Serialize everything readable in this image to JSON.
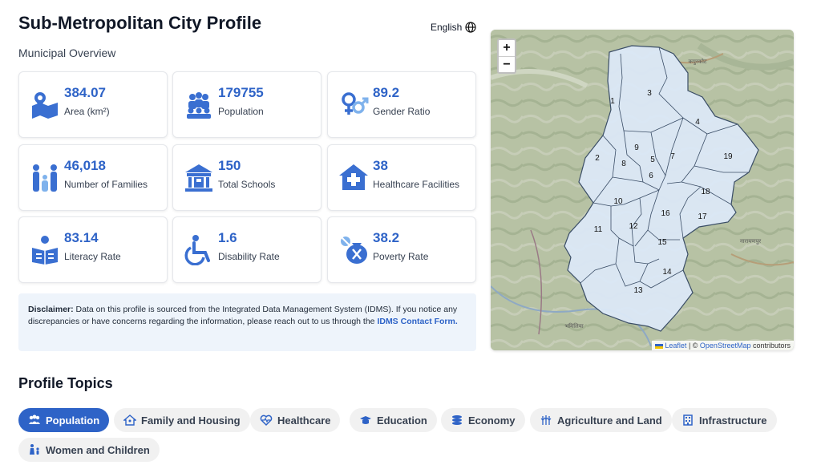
{
  "header": {
    "title": "Sub-Metropolitan City Profile",
    "language": "English",
    "subtitle": "Municipal Overview"
  },
  "stats": [
    {
      "value": "384.07",
      "label": "Area (km²)",
      "icon": "map-area-icon"
    },
    {
      "value": "179755",
      "label": "Population",
      "icon": "people-group-icon"
    },
    {
      "value": "89.2",
      "label": "Gender Ratio",
      "icon": "gender-icon"
    },
    {
      "value": "46,018",
      "label": "Number of Families",
      "icon": "family-icon"
    },
    {
      "value": "150",
      "label": "Total Schools",
      "icon": "school-icon"
    },
    {
      "value": "38",
      "label": "Healthcare Facilities",
      "icon": "hospital-icon"
    },
    {
      "value": "83.14",
      "label": "Literacy Rate",
      "icon": "reader-icon"
    },
    {
      "value": "1.6",
      "label": "Disability Rate",
      "icon": "wheelchair-icon"
    },
    {
      "value": "38.2",
      "label": "Poverty Rate",
      "icon": "money-bag-icon"
    }
  ],
  "disclaimer": {
    "label": "Disclaimer:",
    "text": " Data on this profile is sourced from the Integrated Data Management System (IDMS). If you notice any discrepancies or have concerns regarding the information, please reach out to us through the ",
    "link": "IDMS Contact Form."
  },
  "map": {
    "zoom_in": "+",
    "zoom_out": "−",
    "attribution_leaflet": "Leaflet",
    "attribution_sep": " | © ",
    "attribution_osm": "OpenStreetMap",
    "attribution_rest": " contributors",
    "place_labels": [
      "कपुरकोट",
      "नारायणपुर",
      "भमिलिया"
    ],
    "wards": [
      "1",
      "2",
      "3",
      "4",
      "5",
      "6",
      "7",
      "8",
      "9",
      "10",
      "11",
      "12",
      "13",
      "14",
      "15",
      "16",
      "17",
      "18",
      "19"
    ]
  },
  "topics": {
    "title": "Profile Topics",
    "items": [
      {
        "label": "Population",
        "icon": "people-icon",
        "active": true
      },
      {
        "label": "Family and Housing",
        "icon": "house-icon",
        "active": false
      },
      {
        "label": "Healthcare",
        "icon": "heart-pulse-icon",
        "active": false
      },
      {
        "label": "Education",
        "icon": "graduation-cap-icon",
        "active": false
      },
      {
        "label": "Economy",
        "icon": "coins-icon",
        "active": false
      },
      {
        "label": "Agriculture and Land",
        "icon": "wheat-icon",
        "active": false
      },
      {
        "label": "Infrastructure",
        "icon": "building-icon",
        "active": false
      },
      {
        "label": "Women and Children",
        "icon": "mother-child-icon",
        "active": false
      }
    ]
  },
  "colors": {
    "accent": "#2e63c7",
    "icon_blue": "#3a6fd1",
    "ward_fill": "#dbe8f7"
  }
}
